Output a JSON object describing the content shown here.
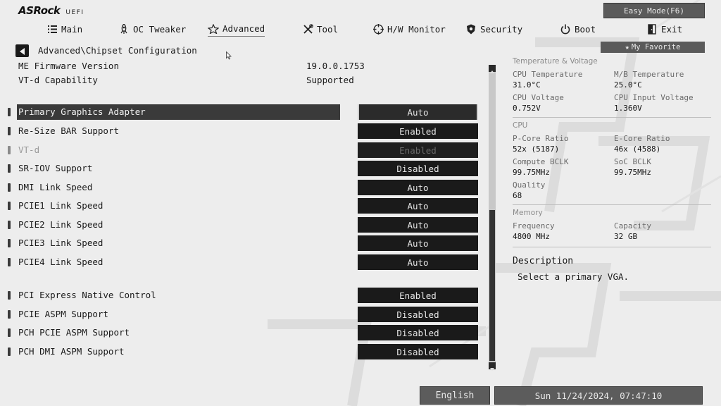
{
  "header": {
    "brand": "ASRock",
    "firmware_type": "UEFI",
    "easy_mode_label": "Easy Mode(F6)",
    "favorite_label": "My Favorite"
  },
  "nav": [
    {
      "label": "Main",
      "icon": "list-icon"
    },
    {
      "label": "OC Tweaker",
      "icon": "rocket-icon"
    },
    {
      "label": "Advanced",
      "icon": "star-icon",
      "active": true
    },
    {
      "label": "Tool",
      "icon": "tools-icon"
    },
    {
      "label": "H/W Monitor",
      "icon": "crosshair-icon"
    },
    {
      "label": "Security",
      "icon": "shield-icon"
    },
    {
      "label": "Boot",
      "icon": "power-icon"
    },
    {
      "label": "Exit",
      "icon": "exit-icon"
    }
  ],
  "breadcrumb": "Advanced\\Chipset Configuration",
  "info": [
    {
      "label": "ME Firmware Version",
      "value": "19.0.0.1753"
    },
    {
      "label": "VT-d Capability",
      "value": "Supported"
    }
  ],
  "settings": [
    {
      "label": "Primary Graphics Adapter",
      "value": "Auto",
      "selected": true
    },
    {
      "label": "Re-Size BAR Support",
      "value": "Enabled"
    },
    {
      "label": "VT-d",
      "value": "Enabled",
      "disabled": true
    },
    {
      "label": "SR-IOV Support",
      "value": "Disabled"
    },
    {
      "label": "DMI Link Speed",
      "value": "Auto"
    },
    {
      "label": "PCIE1 Link Speed",
      "value": "Auto"
    },
    {
      "label": "PCIE2 Link Speed",
      "value": "Auto"
    },
    {
      "label": "PCIE3 Link Speed",
      "value": "Auto"
    },
    {
      "label": "PCIE4 Link Speed",
      "value": "Auto"
    },
    {
      "label": "PCI Express Native Control",
      "value": "Enabled"
    },
    {
      "label": "PCIE ASPM Support",
      "value": "Disabled"
    },
    {
      "label": "PCH PCIE ASPM Support",
      "value": "Disabled"
    },
    {
      "label": "PCH DMI ASPM Support",
      "value": "Disabled"
    }
  ],
  "monitor": {
    "temp_section": "Temperature & Voltage",
    "cpu_temp_label": "CPU Temperature",
    "cpu_temp_value": "31.0°C",
    "mb_temp_label": "M/B Temperature",
    "mb_temp_value": "25.0°C",
    "cpu_voltage_label": "CPU Voltage",
    "cpu_voltage_value": "0.752V",
    "cpu_input_voltage_label": "CPU Input Voltage",
    "cpu_input_voltage_value": "1.360V",
    "cpu_section": "CPU",
    "pcore_label": "P-Core Ratio",
    "pcore_value": "52x (5187)",
    "ecore_label": "E-Core Ratio",
    "ecore_value": "46x (4588)",
    "compute_bclk_label": "Compute BCLK",
    "compute_bclk_value": "99.75MHz",
    "soc_bclk_label": "SoC BCLK",
    "soc_bclk_value": "99.75MHz",
    "quality_label": "Quality",
    "quality_value": "68",
    "memory_section": "Memory",
    "frequency_label": "Frequency",
    "frequency_value": "4800 MHz",
    "capacity_label": "Capacity",
    "capacity_value": "32 GB"
  },
  "description": {
    "title": "Description",
    "text": "Select a primary VGA."
  },
  "footer": {
    "language": "English",
    "datetime": "Sun 11/24/2024, 07:47:10"
  },
  "colors": {
    "background": "#ededed",
    "value_box": "#1a1a1a",
    "selected_row": "#3a3a3a",
    "footer_button": "#5c5c5c"
  }
}
